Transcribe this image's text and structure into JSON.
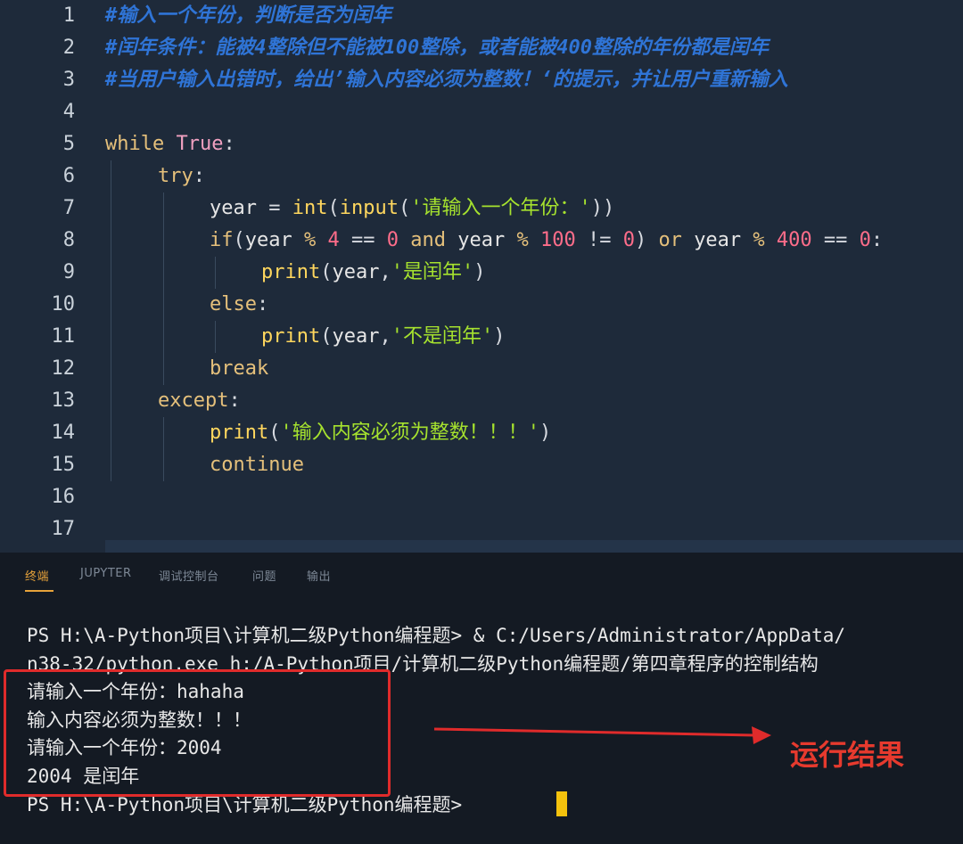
{
  "editor": {
    "line_numbers": [
      "1",
      "2",
      "3",
      "4",
      "5",
      "6",
      "7",
      "8",
      "9",
      "10",
      "11",
      "12",
      "13",
      "14",
      "15",
      "16",
      "17"
    ],
    "comments": {
      "l1": "#输入一个年份，判断是否为闰年",
      "l2": "#闰年条件：能被4整除但不能被100整除，或者能被400整除的年份都是闰年",
      "l3": "#当用户输入出错时，给出’输入内容必须为整数！‘的提示，并让用户重新输入"
    },
    "code": {
      "while": "while",
      "true": "True",
      "colon": ":",
      "try": "try",
      "year": "year",
      "eq": " = ",
      "int": "int",
      "input": "input",
      "prompt_str": "'请输入一个年份：'",
      "if": "if",
      "mod": " % ",
      "n4": "4",
      "eqeq": " == ",
      "n0": "0",
      "and": "and",
      "n100": "100",
      "neq": " != ",
      "or": "or",
      "n400": "400",
      "print": "print",
      "leap_str": "'是闰年'",
      "else": "else",
      "notleap_str": "'不是闰年'",
      "break": "break",
      "except": "except",
      "error_str": "'输入内容必须为整数！！！'",
      "continue": "continue"
    }
  },
  "panel": {
    "tabs": [
      "终端",
      "JUPYTER",
      "调试控制台",
      "问题",
      "输出"
    ],
    "active_tab": "终端",
    "terminal_lines": [
      "PS H:\\A-Python项目\\计算机二级Python编程题> & C:/Users/Administrator/AppData/",
      "n38-32/python.exe h:/A-Python项目/计算机二级Python编程题/第四章程序的控制结构",
      "请输入一个年份：hahaha",
      "输入内容必须为整数！！！",
      "请输入一个年份：2004",
      "2004 是闰年",
      "PS H:\\A-Python项目\\计算机二级Python编程题> "
    ]
  },
  "annotation": {
    "result_label": "运行结果",
    "box_color": "#e02b2b",
    "cursor_color": "#f4c20d"
  }
}
